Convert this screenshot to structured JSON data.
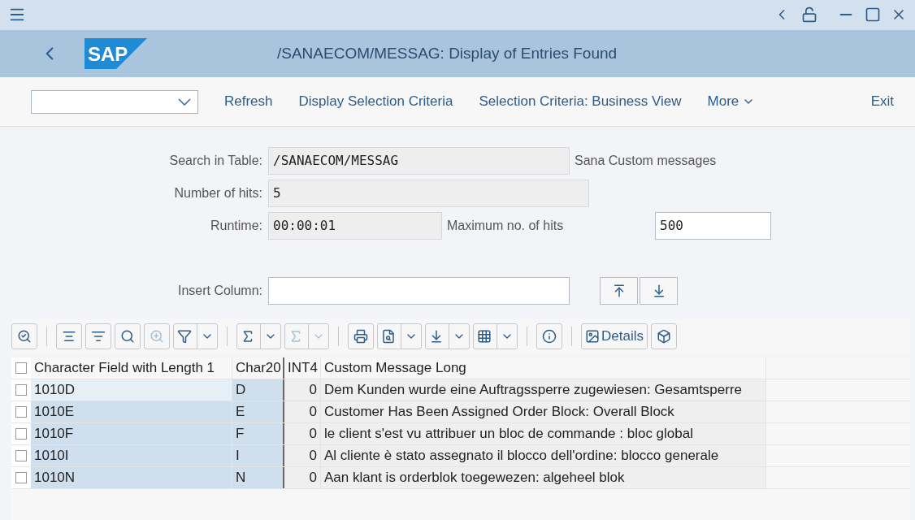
{
  "window": {
    "title": "/SANAECOM/MESSAG: Display of Entries Found",
    "logo": "SAP"
  },
  "toolbar": {
    "buttons": [
      "Refresh",
      "Display Selection Criteria",
      "Selection Criteria: Business View"
    ],
    "more": "More",
    "exit": "Exit"
  },
  "form": {
    "search_label": "Search in Table:",
    "search_value": "/SANAECOM/MESSAG",
    "search_description": "Sana Custom messages",
    "hits_label": "Number of hits:",
    "hits_value": "5",
    "runtime_label": "Runtime:",
    "runtime_value": "00:00:01",
    "max_label": "Maximum no. of hits",
    "max_value": "500",
    "insert_label": "Insert Column:"
  },
  "grid_toolbar": [
    {
      "kind": "button",
      "disabled": false
    },
    {
      "kind": "separator"
    },
    {
      "kind": "button",
      "disabled": false
    },
    {
      "kind": "button",
      "disabled": false
    },
    {
      "kind": "button",
      "disabled": false
    },
    {
      "kind": "button",
      "disabled": true
    },
    {
      "kind": "split",
      "disabled": false
    },
    {
      "kind": "separator"
    },
    {
      "kind": "split",
      "disabled": false
    },
    {
      "kind": "split",
      "disabled": true
    },
    {
      "kind": "separator"
    },
    {
      "kind": "button",
      "disabled": false
    },
    {
      "kind": "split",
      "disabled": false
    },
    {
      "kind": "split",
      "disabled": false
    },
    {
      "kind": "split",
      "disabled": false
    },
    {
      "kind": "separator"
    },
    {
      "kind": "button",
      "disabled": false
    },
    {
      "kind": "separator"
    },
    {
      "kind": "text",
      "label": "Details",
      "disabled": false
    },
    {
      "kind": "button",
      "disabled": false
    }
  ],
  "table": {
    "select_all": false,
    "columns": [
      "Character Field with Length 1",
      "Char20",
      "INT4",
      "Custom Message Long"
    ],
    "rows": [
      {
        "selected": false,
        "cells": [
          "1010D",
          "D",
          "0",
          "Dem Kunden wurde eine Auftragssperre zugewiesen: Gesamtsperre"
        ]
      },
      {
        "selected": false,
        "cells": [
          "1010E",
          "E",
          "0",
          "Customer Has Been Assigned Order Block: Overall Block"
        ]
      },
      {
        "selected": false,
        "cells": [
          "1010F",
          "F",
          "0",
          "le client s'est vu attribuer un bloc de commande : bloc global"
        ]
      },
      {
        "selected": false,
        "cells": [
          "1010I",
          "I",
          "0",
          "Al cliente è stato assegnato il blocco dell'ordine: blocco generale"
        ]
      },
      {
        "selected": false,
        "cells": [
          "1010N",
          "N",
          "0",
          "Aan klant is orderblok toegewezen: algeheel blok"
        ]
      }
    ]
  }
}
